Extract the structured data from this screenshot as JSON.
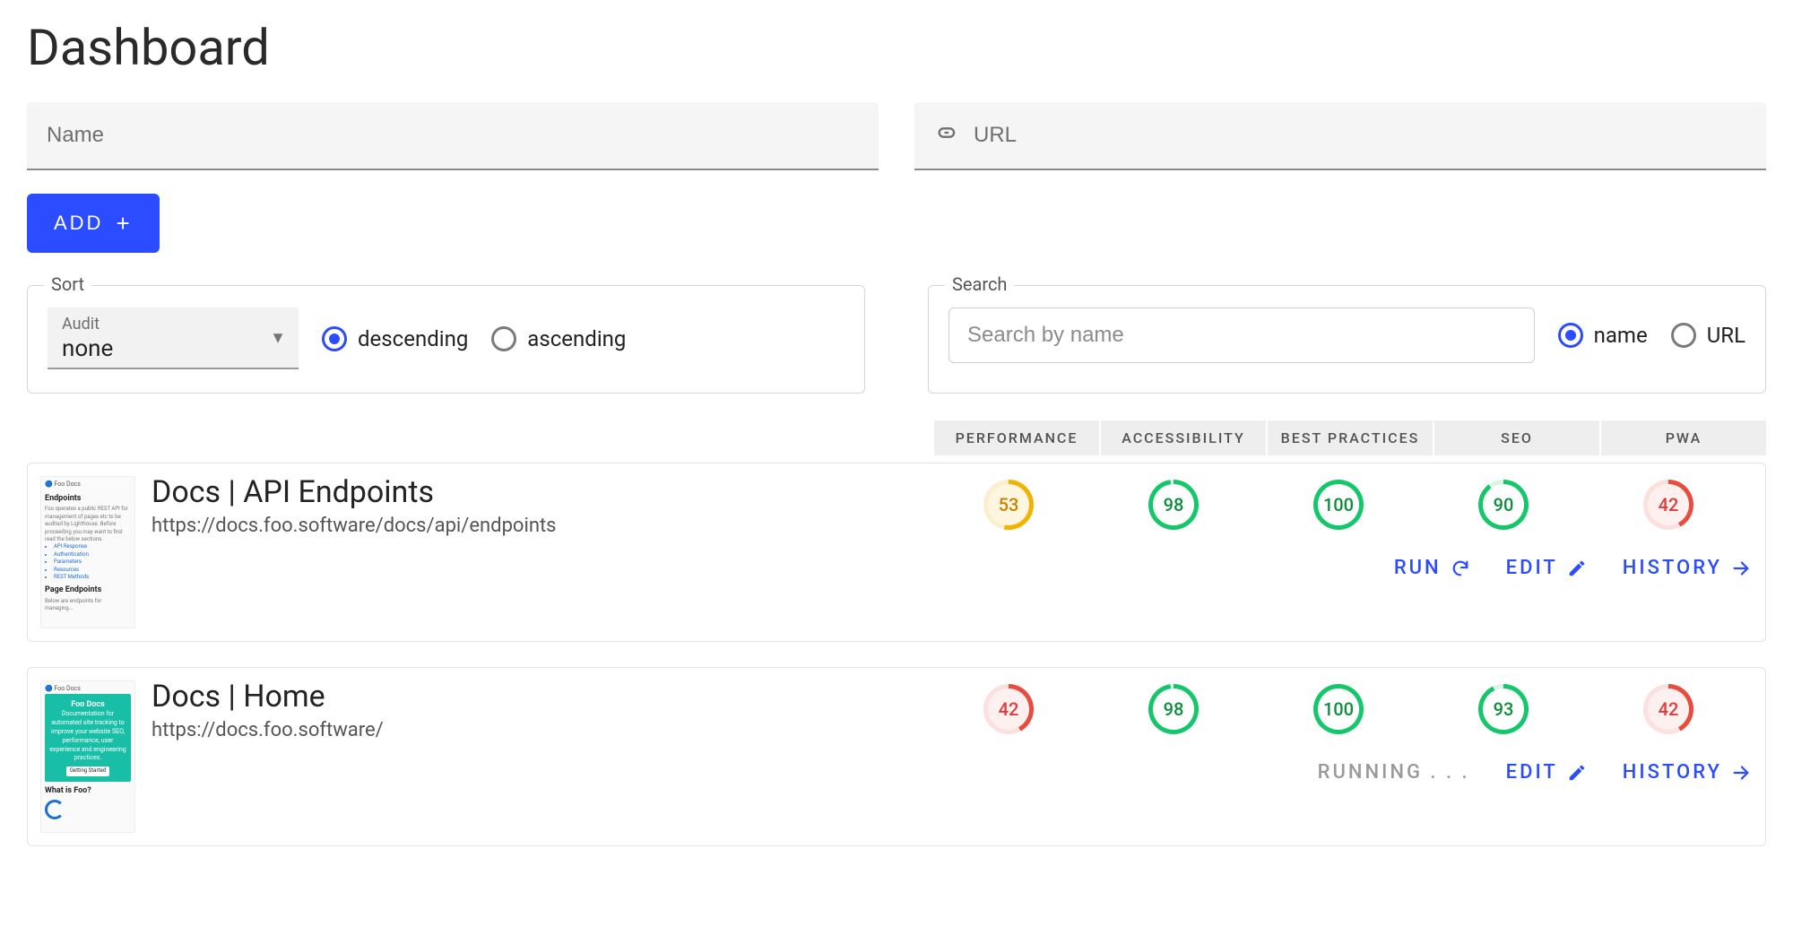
{
  "page_title": "Dashboard",
  "name_field": {
    "placeholder": "Name",
    "value": ""
  },
  "url_field": {
    "placeholder": "URL",
    "value": ""
  },
  "add_button": {
    "label": "ADD"
  },
  "sort": {
    "legend": "Sort",
    "select_label": "Audit",
    "select_value": "none",
    "options": [
      {
        "id": "desc",
        "label": "descending",
        "checked": true
      },
      {
        "id": "asc",
        "label": "ascending",
        "checked": false
      }
    ]
  },
  "search": {
    "legend": "Search",
    "placeholder": "Search by name",
    "value": "",
    "options": [
      {
        "id": "name",
        "label": "name",
        "checked": true
      },
      {
        "id": "url",
        "label": "URL",
        "checked": false
      }
    ]
  },
  "score_columns": [
    "PERFORMANCE",
    "ACCESSIBILITY",
    "BEST PRACTICES",
    "SEO",
    "PWA"
  ],
  "actions": {
    "run": "RUN",
    "edit": "EDIT",
    "history": "HISTORY",
    "running": "RUNNING . . ."
  },
  "items": [
    {
      "title": "Docs | API Endpoints",
      "url": "https://docs.foo.software/docs/api/endpoints",
      "thumb": "endpoints",
      "scores": [
        {
          "value": 53,
          "level": "avg"
        },
        {
          "value": 98,
          "level": "good"
        },
        {
          "value": 100,
          "level": "good"
        },
        {
          "value": 90,
          "level": "good"
        },
        {
          "value": 42,
          "level": "bad"
        }
      ],
      "status": "idle"
    },
    {
      "title": "Docs | Home",
      "url": "https://docs.foo.software/",
      "thumb": "home",
      "scores": [
        {
          "value": 42,
          "level": "bad"
        },
        {
          "value": 98,
          "level": "good"
        },
        {
          "value": 100,
          "level": "good"
        },
        {
          "value": 93,
          "level": "good"
        },
        {
          "value": 42,
          "level": "bad"
        }
      ],
      "status": "running"
    }
  ]
}
